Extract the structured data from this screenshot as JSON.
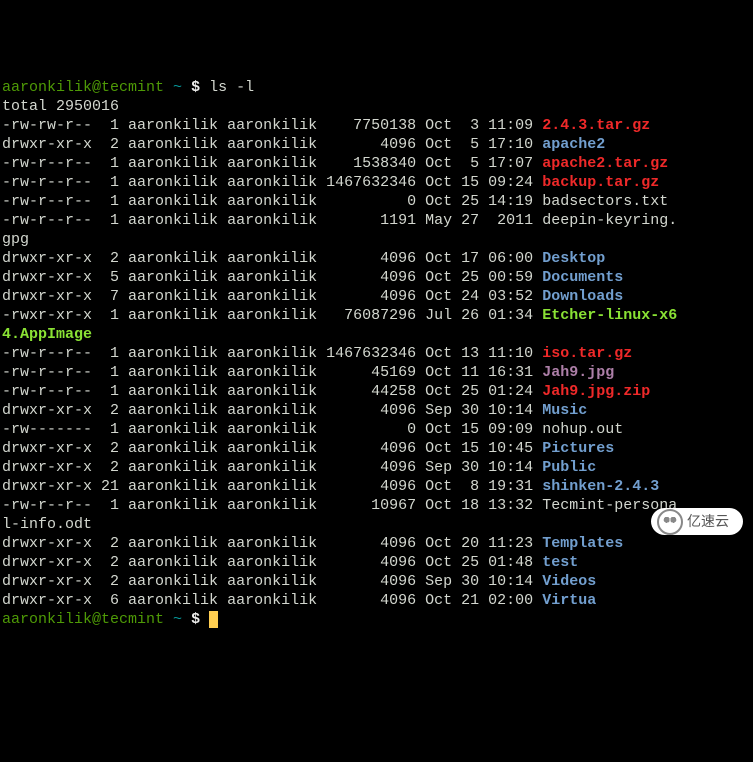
{
  "prompt": {
    "user_host": "aaronkilik@tecmint",
    "tilde": "~",
    "dollar": "$",
    "command": "ls -l"
  },
  "total_line": "total 2950016",
  "rows": [
    {
      "perm": "-rw-rw-r--",
      "links": "1",
      "owner": "aaronkilik",
      "group": "aaronkilik",
      "size": "7750138",
      "date": "Oct  3 11:09",
      "name": "2.4.3.tar.gz",
      "cls": "red-bold"
    },
    {
      "perm": "drwxr-xr-x",
      "links": "2",
      "owner": "aaronkilik",
      "group": "aaronkilik",
      "size": "4096",
      "date": "Oct  5 17:10",
      "name": "apache2",
      "cls": "blue-bold"
    },
    {
      "perm": "-rw-r--r--",
      "links": "1",
      "owner": "aaronkilik",
      "group": "aaronkilik",
      "size": "1538340",
      "date": "Oct  5 17:07",
      "name": "apache2.tar.gz",
      "cls": "red-bold"
    },
    {
      "perm": "-rw-r--r--",
      "links": "1",
      "owner": "aaronkilik",
      "group": "aaronkilik",
      "size": "1467632346",
      "date": "Oct 15 09:24",
      "name": "backup.tar.gz",
      "cls": "red-bold"
    },
    {
      "perm": "-rw-r--r--",
      "links": "1",
      "owner": "aaronkilik",
      "group": "aaronkilik",
      "size": "0",
      "date": "Oct 25 14:19",
      "name": "badsectors.txt",
      "cls": "white"
    },
    {
      "perm": "-rw-r--r--",
      "links": "1",
      "owner": "aaronkilik",
      "group": "aaronkilik",
      "size": "1191",
      "date": "May 27  2011",
      "name": "deepin-keyring.",
      "cls": "white",
      "wrap": "gpg"
    },
    {
      "perm": "drwxr-xr-x",
      "links": "2",
      "owner": "aaronkilik",
      "group": "aaronkilik",
      "size": "4096",
      "date": "Oct 17 06:00",
      "name": "Desktop",
      "cls": "blue-bold"
    },
    {
      "perm": "drwxr-xr-x",
      "links": "5",
      "owner": "aaronkilik",
      "group": "aaronkilik",
      "size": "4096",
      "date": "Oct 25 00:59",
      "name": "Documents",
      "cls": "blue-bold"
    },
    {
      "perm": "drwxr-xr-x",
      "links": "7",
      "owner": "aaronkilik",
      "group": "aaronkilik",
      "size": "4096",
      "date": "Oct 24 03:52",
      "name": "Downloads",
      "cls": "blue-bold"
    },
    {
      "perm": "-rwxr-xr-x",
      "links": "1",
      "owner": "aaronkilik",
      "group": "aaronkilik",
      "size": "76087296",
      "date": "Jul 26 01:34",
      "name": "Etcher-linux-x6",
      "cls": "green-bold",
      "wrap": "4.AppImage"
    },
    {
      "perm": "-rw-r--r--",
      "links": "1",
      "owner": "aaronkilik",
      "group": "aaronkilik",
      "size": "1467632346",
      "date": "Oct 13 11:10",
      "name": "iso.tar.gz",
      "cls": "red-bold"
    },
    {
      "perm": "-rw-r--r--",
      "links": "1",
      "owner": "aaronkilik",
      "group": "aaronkilik",
      "size": "45169",
      "date": "Oct 11 16:31",
      "name": "Jah9.jpg",
      "cls": "magenta-bold"
    },
    {
      "perm": "-rw-r--r--",
      "links": "1",
      "owner": "aaronkilik",
      "group": "aaronkilik",
      "size": "44258",
      "date": "Oct 25 01:24",
      "name": "Jah9.jpg.zip",
      "cls": "red-bold"
    },
    {
      "perm": "drwxr-xr-x",
      "links": "2",
      "owner": "aaronkilik",
      "group": "aaronkilik",
      "size": "4096",
      "date": "Sep 30 10:14",
      "name": "Music",
      "cls": "blue-bold"
    },
    {
      "perm": "-rw-------",
      "links": "1",
      "owner": "aaronkilik",
      "group": "aaronkilik",
      "size": "0",
      "date": "Oct 15 09:09",
      "name": "nohup.out",
      "cls": "white"
    },
    {
      "perm": "drwxr-xr-x",
      "links": "2",
      "owner": "aaronkilik",
      "group": "aaronkilik",
      "size": "4096",
      "date": "Oct 15 10:45",
      "name": "Pictures",
      "cls": "blue-bold"
    },
    {
      "perm": "drwxr-xr-x",
      "links": "2",
      "owner": "aaronkilik",
      "group": "aaronkilik",
      "size": "4096",
      "date": "Sep 30 10:14",
      "name": "Public",
      "cls": "blue-bold"
    },
    {
      "perm": "drwxr-xr-x",
      "links": "21",
      "owner": "aaronkilik",
      "group": "aaronkilik",
      "size": "4096",
      "date": "Oct  8 19:31",
      "name": "shinken-2.4.3",
      "cls": "blue-bold"
    },
    {
      "perm": "-rw-r--r--",
      "links": "1",
      "owner": "aaronkilik",
      "group": "aaronkilik",
      "size": "10967",
      "date": "Oct 18 13:32",
      "name": "Tecmint-persona",
      "cls": "white",
      "wrap": "l-info.odt"
    },
    {
      "perm": "drwxr-xr-x",
      "links": "2",
      "owner": "aaronkilik",
      "group": "aaronkilik",
      "size": "4096",
      "date": "Oct 20 11:23",
      "name": "Templates",
      "cls": "blue-bold"
    },
    {
      "perm": "drwxr-xr-x",
      "links": "2",
      "owner": "aaronkilik",
      "group": "aaronkilik",
      "size": "4096",
      "date": "Oct 25 01:48",
      "name": "test",
      "cls": "blue-bold"
    },
    {
      "perm": "drwxr-xr-x",
      "links": "2",
      "owner": "aaronkilik",
      "group": "aaronkilik",
      "size": "4096",
      "date": "Sep 30 10:14",
      "name": "Videos",
      "cls": "blue-bold"
    },
    {
      "perm": "drwxr-xr-x",
      "links": "6",
      "owner": "aaronkilik",
      "group": "aaronkilik",
      "size": "4096",
      "date": "Oct 21 02:00",
      "name": "Virtua",
      "cls": "blue-bold"
    }
  ],
  "watermark": "亿速云"
}
